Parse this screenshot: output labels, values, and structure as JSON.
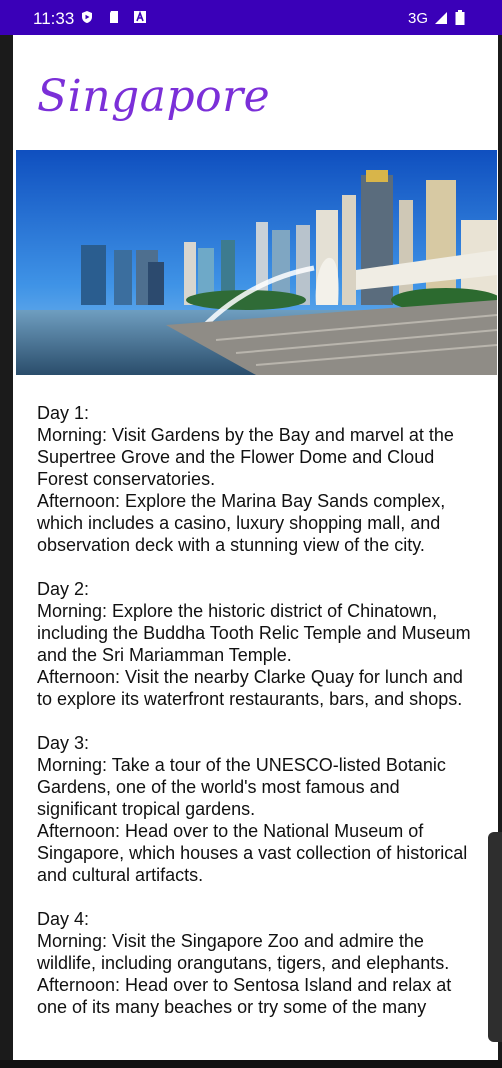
{
  "status_bar": {
    "time": "11:33",
    "network": "3G",
    "icons": [
      "shield-play-icon",
      "sd-card-icon",
      "a-badge-icon",
      "signal-icon",
      "battery-icon"
    ]
  },
  "page": {
    "title": "Singapore",
    "image": "singapore-skyline-merlion-image"
  },
  "itinerary": [
    {
      "day": "Day 1:",
      "morning": "Morning: Visit Gardens by the Bay and marvel at the Supertree Grove and the Flower Dome and Cloud Forest conservatories.",
      "afternoon": "Afternoon: Explore the Marina Bay Sands complex, which includes a casino, luxury shopping mall, and observation deck with a stunning view of the city."
    },
    {
      "day": "Day 2:",
      "morning": "Morning: Explore the historic district of Chinatown, including the Buddha Tooth Relic Temple and Museum and the Sri Mariamman Temple.",
      "afternoon": "Afternoon: Visit the nearby Clarke Quay for lunch and to explore its waterfront restaurants, bars, and shops."
    },
    {
      "day": "Day 3:",
      "morning": "Morning: Take a tour of the UNESCO-listed Botanic Gardens, one of the world's most famous and significant tropical gardens.",
      "afternoon": "Afternoon: Head over to the National Museum of Singapore, which houses a vast collection of historical and cultural artifacts."
    },
    {
      "day": "Day 4:",
      "morning": "Morning: Visit the Singapore Zoo and admire the wildlife, including orangutans, tigers, and elephants.",
      "afternoon": "Afternoon: Head over to Sentosa Island and relax at one of its many beaches or try some of the many"
    }
  ],
  "colors": {
    "status_bar": "#3a00b8",
    "title": "#7b2fd8"
  }
}
